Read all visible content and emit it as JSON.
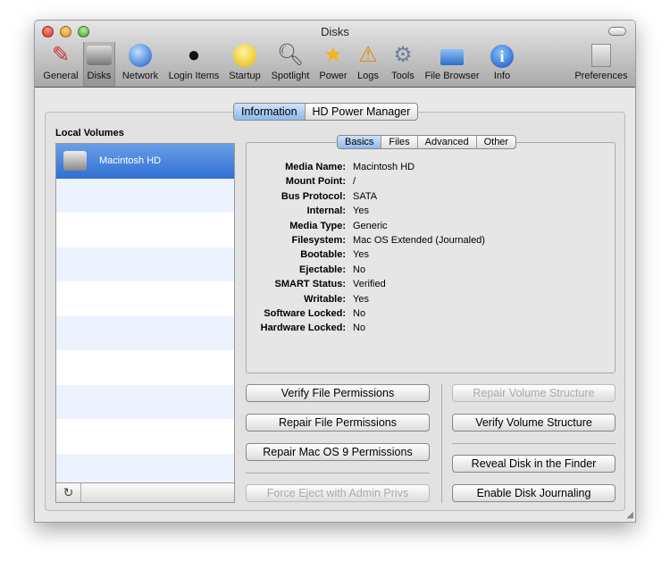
{
  "window": {
    "title": "Disks"
  },
  "toolbar": [
    {
      "label": "General",
      "icon": "general-icon"
    },
    {
      "label": "Disks",
      "icon": "disk-icon",
      "selected": true
    },
    {
      "label": "Network",
      "icon": "globe-icon"
    },
    {
      "label": "Login Items",
      "icon": "user-icon"
    },
    {
      "label": "Startup",
      "icon": "startup-icon"
    },
    {
      "label": "Spotlight",
      "icon": "magnifier-icon"
    },
    {
      "label": "Power",
      "icon": "star-icon"
    },
    {
      "label": "Logs",
      "icon": "warning-icon"
    },
    {
      "label": "Tools",
      "icon": "gear-icon"
    },
    {
      "label": "File Browser",
      "icon": "folder-search-icon"
    },
    {
      "label": "Info",
      "icon": "info-icon"
    },
    {
      "label": "Preferences",
      "icon": "switch-icon"
    }
  ],
  "main_tabs": [
    "Information",
    "HD Power Manager"
  ],
  "sub_tabs": [
    "Basics",
    "Files",
    "Advanced",
    "Other"
  ],
  "volumes": {
    "header": "Local Volumes",
    "items": [
      "Macintosh HD"
    ]
  },
  "details": [
    {
      "k": "Media Name:",
      "v": "Macintosh HD"
    },
    {
      "k": "Mount Point:",
      "v": "/"
    },
    {
      "k": "Bus Protocol:",
      "v": "SATA"
    },
    {
      "k": "Internal:",
      "v": "Yes"
    },
    {
      "k": "Media Type:",
      "v": "Generic"
    },
    {
      "k": "Filesystem:",
      "v": "Mac OS Extended (Journaled)"
    },
    {
      "k": "Bootable:",
      "v": "Yes"
    },
    {
      "k": "Ejectable:",
      "v": "No"
    },
    {
      "k": "SMART Status:",
      "v": "Verified"
    },
    {
      "k": "Writable:",
      "v": "Yes"
    },
    {
      "k": "Software Locked:",
      "v": "No"
    },
    {
      "k": "Hardware Locked:",
      "v": "No"
    }
  ],
  "buttons": {
    "verify_perm": "Verify File Permissions",
    "repair_perm": "Repair File Permissions",
    "repair_os9": "Repair Mac OS 9 Permissions",
    "force_eject": "Force Eject with Admin Privs",
    "repair_vol": "Repair Volume Structure",
    "verify_vol": "Verify Volume Structure",
    "reveal": "Reveal Disk in the Finder",
    "journal": "Enable Disk Journaling"
  }
}
